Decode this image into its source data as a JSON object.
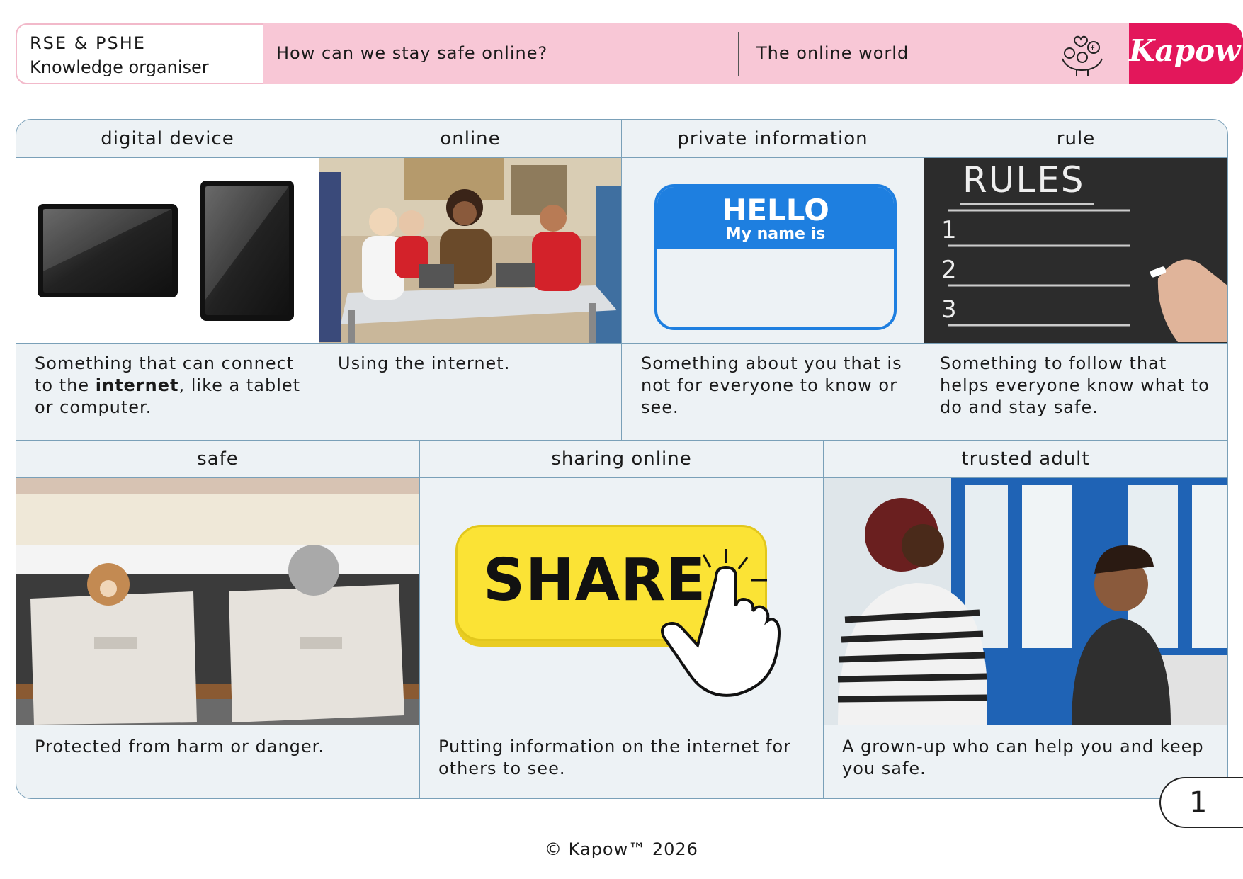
{
  "header": {
    "subject": "RSE & PSHE",
    "doc_type": "Knowledge organiser",
    "question": "How can we stay safe online?",
    "topic": "The online world",
    "logo": "Kapow",
    "logo_mark": "™",
    "icon": "hands-holding-hearts-icon"
  },
  "cards_top": [
    {
      "term": "digital device",
      "definition_before": "Something that can connect to the ",
      "definition_bold": "internet",
      "definition_after": ", like a tablet or computer."
    },
    {
      "term": "online",
      "definition": "Using the internet."
    },
    {
      "term": "private information",
      "definition": "Something about you that is not for everyone to know or see.",
      "badge_title": "HELLO",
      "badge_sub": "My name is"
    },
    {
      "term": "rule",
      "definition": "Something to follow that helps everyone know what to do and stay safe.",
      "board_title": "RULES",
      "board_numbers": [
        "1",
        "2",
        "3"
      ]
    }
  ],
  "cards_bottom": [
    {
      "term": "safe",
      "definition": "Protected from harm or danger."
    },
    {
      "term": "sharing online",
      "definition": "Putting information on the internet for others to see.",
      "button_text": "SHARE"
    },
    {
      "term": "trusted adult",
      "definition": "A grown-up who can help you and keep you safe."
    }
  ],
  "page_number": "1",
  "footer": "© Kapow™ 2026",
  "colors": {
    "accent_pink": "#f8c7d6",
    "brand": "#e3175b",
    "panel": "#edf2f5",
    "border": "#7aa0b8",
    "badge_blue": "#1e7fe0",
    "share_yellow": "#fbe335"
  }
}
